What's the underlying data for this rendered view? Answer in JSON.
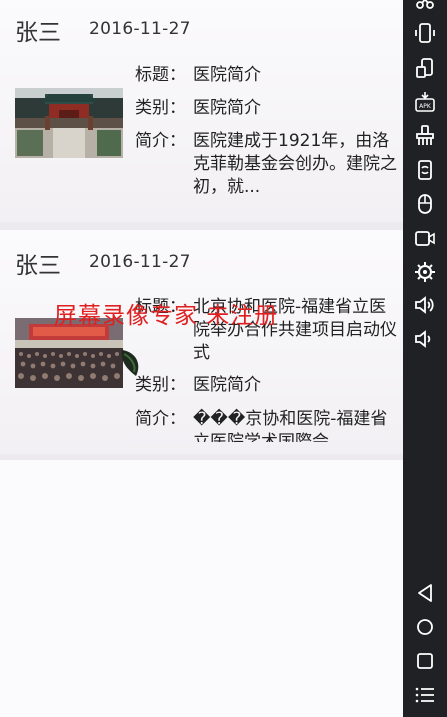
{
  "labels": {
    "title": "标题：",
    "category": "类别：",
    "intro": "简介："
  },
  "items": [
    {
      "author": "张三",
      "date": "2016-11-27",
      "title": "医院简介",
      "category": "医院简介",
      "intro": "医院建成于1921年，由洛克菲勒基金会创办。建院之初，就..."
    },
    {
      "author": "张三",
      "date": "2016-11-27",
      "title": "北京协和医院-福建省立医院举办合作共建项目启动仪式",
      "category": "医院简介",
      "intro": "���京协和医院-福建省立医院学术国際会"
    }
  ],
  "watermark": "屏幕录像专家 未注册",
  "toolbar": {
    "icons": [
      "scissors-icon",
      "rotate-phone-icon",
      "screen-size-icon",
      "apk-install-icon",
      "brush-icon",
      "phone-rotate-icon",
      "mouse-icon",
      "video-record-icon",
      "settings-gear-icon",
      "volume-up-icon",
      "volume-down-icon",
      "back-icon",
      "home-icon",
      "recents-icon",
      "menu-icon"
    ]
  }
}
